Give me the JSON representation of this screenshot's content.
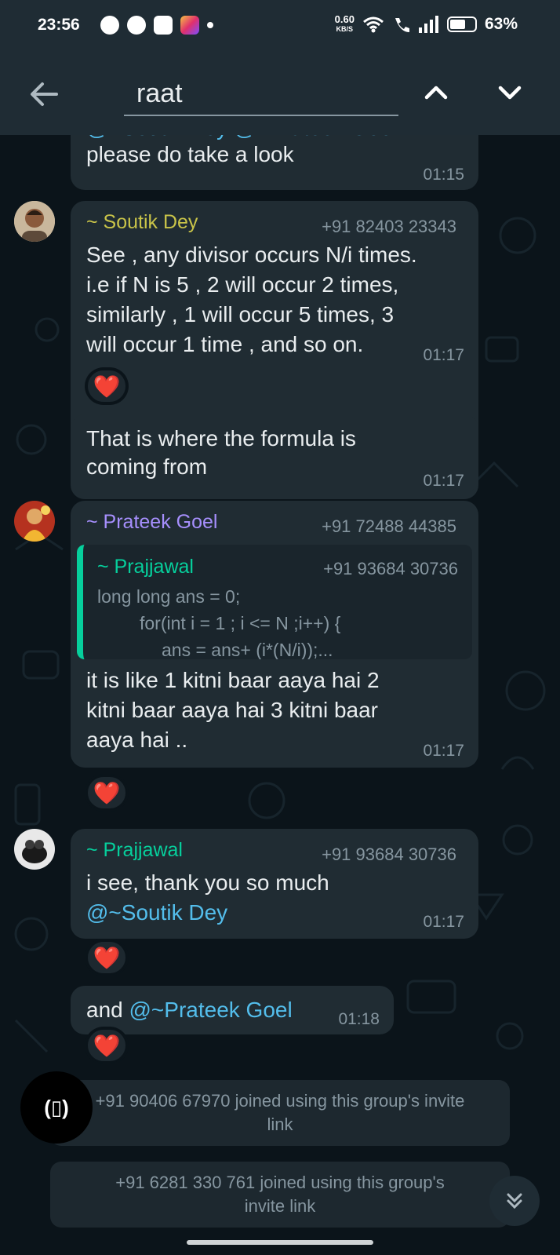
{
  "status_bar": {
    "time": "23:56",
    "net_speed": "0.60",
    "net_unit": "KB/S",
    "battery": "63%",
    "battery_level": 0.63
  },
  "header": {
    "search_value": "raat",
    "back_icon": "arrow-left-icon",
    "up_icon": "chevron-up-icon",
    "down_icon": "chevron-down-icon"
  },
  "messages": [
    {
      "partial_header": "@~Soutik Dey @~Prateek Goel",
      "text": "please do take a look",
      "time": "01:15"
    },
    {
      "sender": "~ Soutik Dey",
      "sender_color": "#c9c449",
      "phone": "+91 82403 23343",
      "lines": [
        "See , any divisor occurs N/i times.",
        "i.e if N is 5 , 2 will occur 2 times,",
        "similarly , 1 will occur 5 times, 3",
        "will occur 1 time , and so on."
      ],
      "time": "01:17",
      "reaction": "❤️"
    },
    {
      "lines": [
        "That is where the formula is",
        "coming from"
      ],
      "time": "01:17"
    },
    {
      "sender": "~ Prateek Goel",
      "sender_color": "#a68ffd",
      "phone": "+91 72488 44385",
      "quote": {
        "sender": "~ Prajjawal",
        "phone": "+91 93684 30736",
        "lines": [
          "long long ans = 0;",
          "for(int i = 1 ; i <= N ;i++) {",
          "ans = ans+ (i*(N/i));..."
        ]
      },
      "lines": [
        "it is like 1 kitni baar aaya hai 2",
        "kitni baar aaya hai 3 kitni baar",
        "aaya hai .."
      ],
      "time": "01:17",
      "reaction": "❤️"
    },
    {
      "sender": "~ Prajjawal",
      "sender_color": "#06cf9c",
      "phone": "+91 93684 30736",
      "line1": "i see, thank you so much",
      "mention": "@~Soutik Dey",
      "time": "01:17",
      "reaction": "❤️"
    },
    {
      "prefix": "and ",
      "mention": "@~Prateek Goel",
      "time": "01:18",
      "reaction": "❤️"
    }
  ],
  "system_messages": [
    {
      "line1": "+91 90406 67970 joined using this group's invite",
      "line2": "link"
    },
    {
      "line1": "+91 6281 330 761 joined using this group's",
      "line2": "invite link"
    }
  ],
  "floating_button_label": "(▯)",
  "colors": {
    "background": "#0b141a",
    "bar": "#1f2c34",
    "bubble": "#202c33",
    "mention": "#53bdeb"
  }
}
